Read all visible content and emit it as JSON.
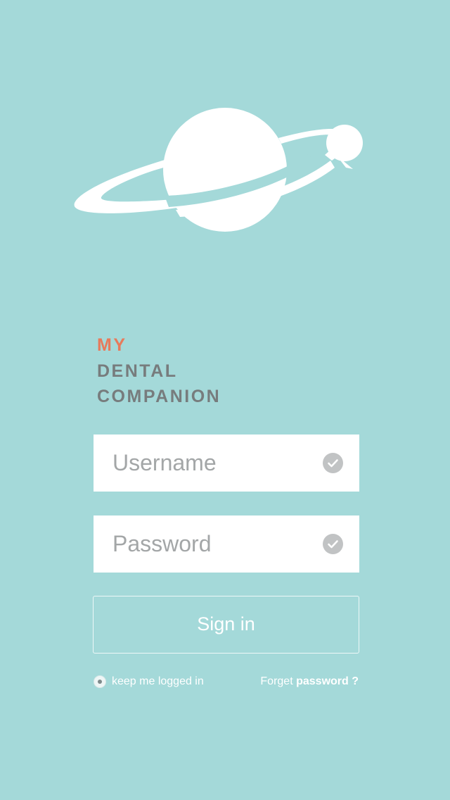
{
  "brand": {
    "line1": "MY",
    "line2": "DENTAL",
    "line3": "COMPANION"
  },
  "form": {
    "username_placeholder": "Username",
    "password_placeholder": "Password",
    "signin_label": "Sign in",
    "keep_logged_in_label": "keep me logged in",
    "forgot_prefix": "Forget",
    "forgot_emphasis": "password ?"
  },
  "colors": {
    "background": "#a4d9d9",
    "brand_accent": "#e77a5b",
    "brand_text": "#777c7d",
    "input_bg": "#ffffff",
    "check_icon": "#c1c3c4"
  },
  "icons": {
    "logo": "planet-logo-icon",
    "username_status": "check-circle-icon",
    "password_status": "check-circle-icon",
    "remember": "radio-button-icon"
  }
}
